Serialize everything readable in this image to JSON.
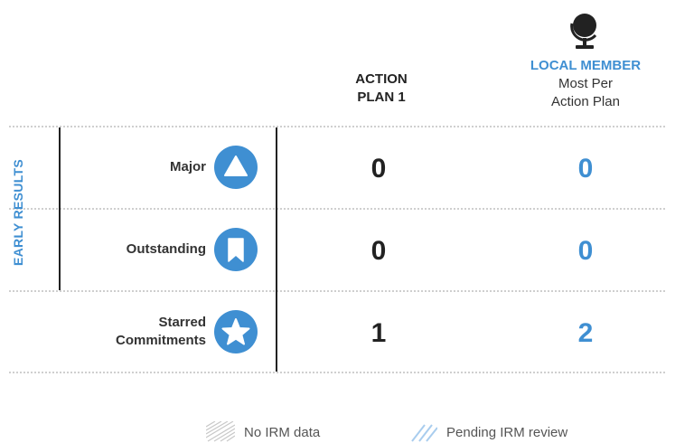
{
  "header": {
    "col1_line1": "ACTION",
    "col1_line2": "PLAN 1",
    "col2_title": "LOCAL MEMBER",
    "col2_line1": "Most Per",
    "col2_line2": "Action Plan",
    "globe_icon": "globe-icon"
  },
  "side_label": "EARLY RESULTS",
  "rows": [
    {
      "label_line1": "Major",
      "label_line2": "",
      "icon": "triangle-icon",
      "action_plan_1": "0",
      "local_member": "0"
    },
    {
      "label_line1": "Outstanding",
      "label_line2": "",
      "icon": "bookmark-icon",
      "action_plan_1": "0",
      "local_member": "0"
    },
    {
      "label_line1": "Starred",
      "label_line2": "Commitments",
      "icon": "star-icon",
      "action_plan_1": "1",
      "local_member": "2"
    }
  ],
  "legend": {
    "no_data": "No IRM data",
    "pending": "Pending IRM review"
  },
  "colors": {
    "accent_blue": "#3f8fd2",
    "text_dark": "#222222",
    "separator": "#cfcfcf"
  }
}
